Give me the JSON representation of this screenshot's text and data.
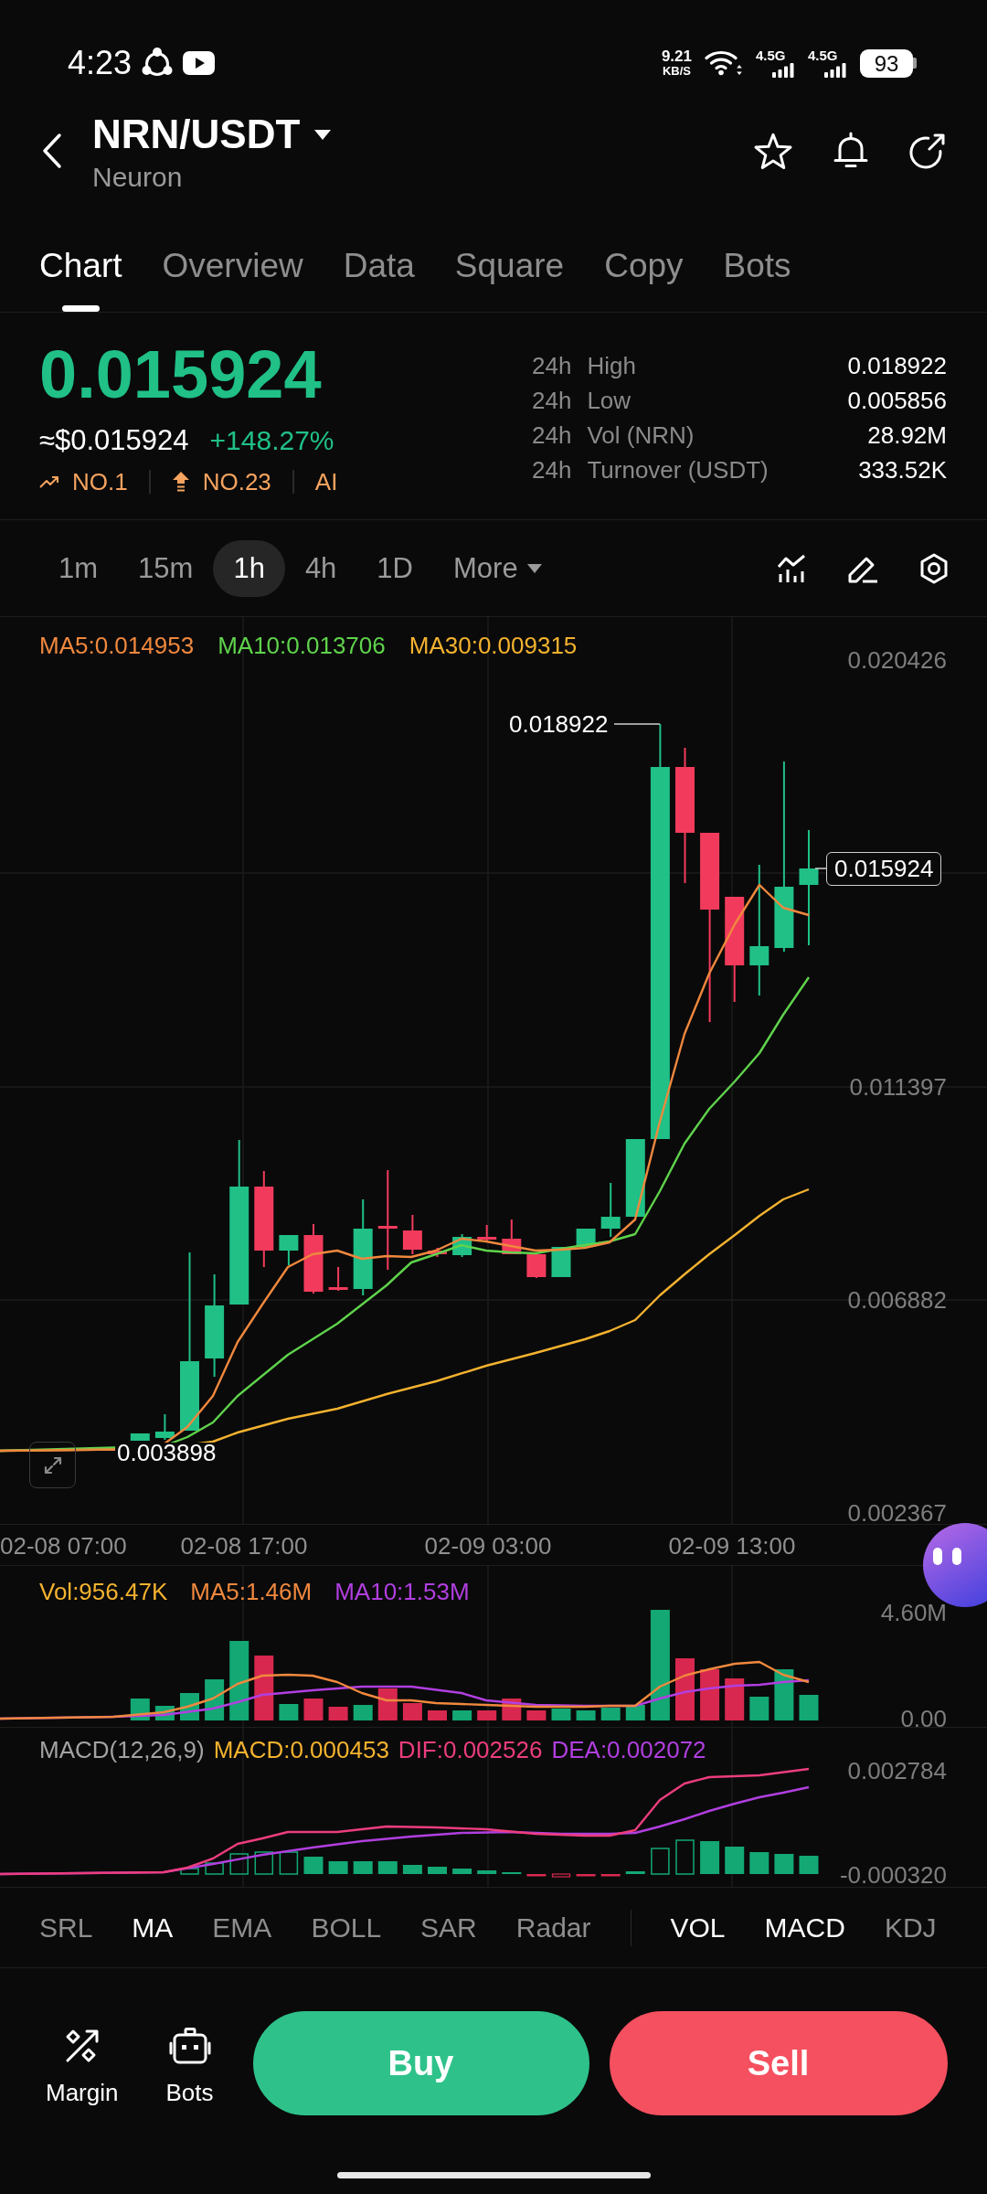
{
  "status_bar": {
    "time": "4:23",
    "net_speed": "9.21",
    "net_unit": "KB/S",
    "networks": [
      "4.5G",
      "4.5G"
    ],
    "battery": "93"
  },
  "header": {
    "pair": "NRN/USDT",
    "name": "Neuron"
  },
  "tabs": [
    {
      "label": "Chart",
      "selected": true
    },
    {
      "label": "Overview",
      "selected": false
    },
    {
      "label": "Data",
      "selected": false
    },
    {
      "label": "Square",
      "selected": false
    },
    {
      "label": "Copy",
      "selected": false
    },
    {
      "label": "Bots",
      "selected": false
    }
  ],
  "ticker": {
    "price": "0.015924",
    "usd_price": "≈$0.015924",
    "change": "+148.27%",
    "badges": [
      {
        "kind": "trending",
        "label": "NO.1"
      },
      {
        "kind": "gainer",
        "label": "NO.23"
      },
      {
        "kind": "plain",
        "label": "AI"
      }
    ],
    "stats": [
      {
        "period": "24h",
        "label": "High",
        "value": "0.018922"
      },
      {
        "period": "24h",
        "label": "Low",
        "value": "0.005856"
      },
      {
        "period": "24h",
        "label": "Vol (NRN)",
        "value": "28.92M"
      },
      {
        "period": "24h",
        "label": "Turnover (USDT)",
        "value": "333.52K"
      }
    ]
  },
  "intervals": [
    {
      "label": "1m",
      "selected": false
    },
    {
      "label": "15m",
      "selected": false
    },
    {
      "label": "1h",
      "selected": true
    },
    {
      "label": "4h",
      "selected": false
    },
    {
      "label": "1D",
      "selected": false
    }
  ],
  "more_menu": {
    "label": "More"
  },
  "price_chart": {
    "legend": [
      {
        "label": "MA5:0.014953",
        "color": "#f0883e"
      },
      {
        "label": "MA10:0.013706",
        "color": "#5fd34c"
      },
      {
        "label": "MA30:0.009315",
        "color": "#f4b22f"
      }
    ],
    "y_labels": [
      "0.020426",
      "0.011397",
      "0.006882",
      "0.002367"
    ],
    "high_label": "0.018922",
    "low_label": "0.003898",
    "last_price": "0.015924",
    "x_labels": [
      "02-08 07:00",
      "02-08 17:00",
      "02-09 03:00",
      "02-09 13:00"
    ]
  },
  "volume_chart": {
    "legend": [
      {
        "label": "Vol:956.47K",
        "color": "#f4b22f"
      },
      {
        "label": "MA5:1.46M",
        "color": "#f0883e"
      },
      {
        "label": "MA10:1.53M",
        "color": "#b13fe0"
      }
    ],
    "y_labels": [
      "4.60M",
      "0.00"
    ]
  },
  "macd_chart": {
    "legend": [
      {
        "label": "MACD(12,26,9)",
        "color": "#a3a3a3"
      },
      {
        "label": "MACD:0.000453",
        "color": "#f4b22f"
      },
      {
        "label": "DIF:0.002526",
        "color": "#ec3d7e"
      },
      {
        "label": "DEA:0.002072",
        "color": "#b13fe0"
      }
    ],
    "y_labels": [
      "0.002784",
      "-0.000320"
    ]
  },
  "indicators": {
    "main": [
      {
        "label": "SRL",
        "selected": false
      },
      {
        "label": "MA",
        "selected": true
      },
      {
        "label": "EMA",
        "selected": false
      },
      {
        "label": "BOLL",
        "selected": false
      },
      {
        "label": "SAR",
        "selected": false
      },
      {
        "label": "Radar",
        "selected": false
      }
    ],
    "sub": [
      {
        "label": "VOL",
        "selected": true
      },
      {
        "label": "MACD",
        "selected": true
      },
      {
        "label": "KDJ",
        "selected": false
      }
    ]
  },
  "actions": {
    "shortcuts": [
      {
        "kind": "margin",
        "label": "Margin"
      },
      {
        "kind": "bots",
        "label": "Bots"
      }
    ],
    "buy": "Buy",
    "sell": "Sell"
  }
}
